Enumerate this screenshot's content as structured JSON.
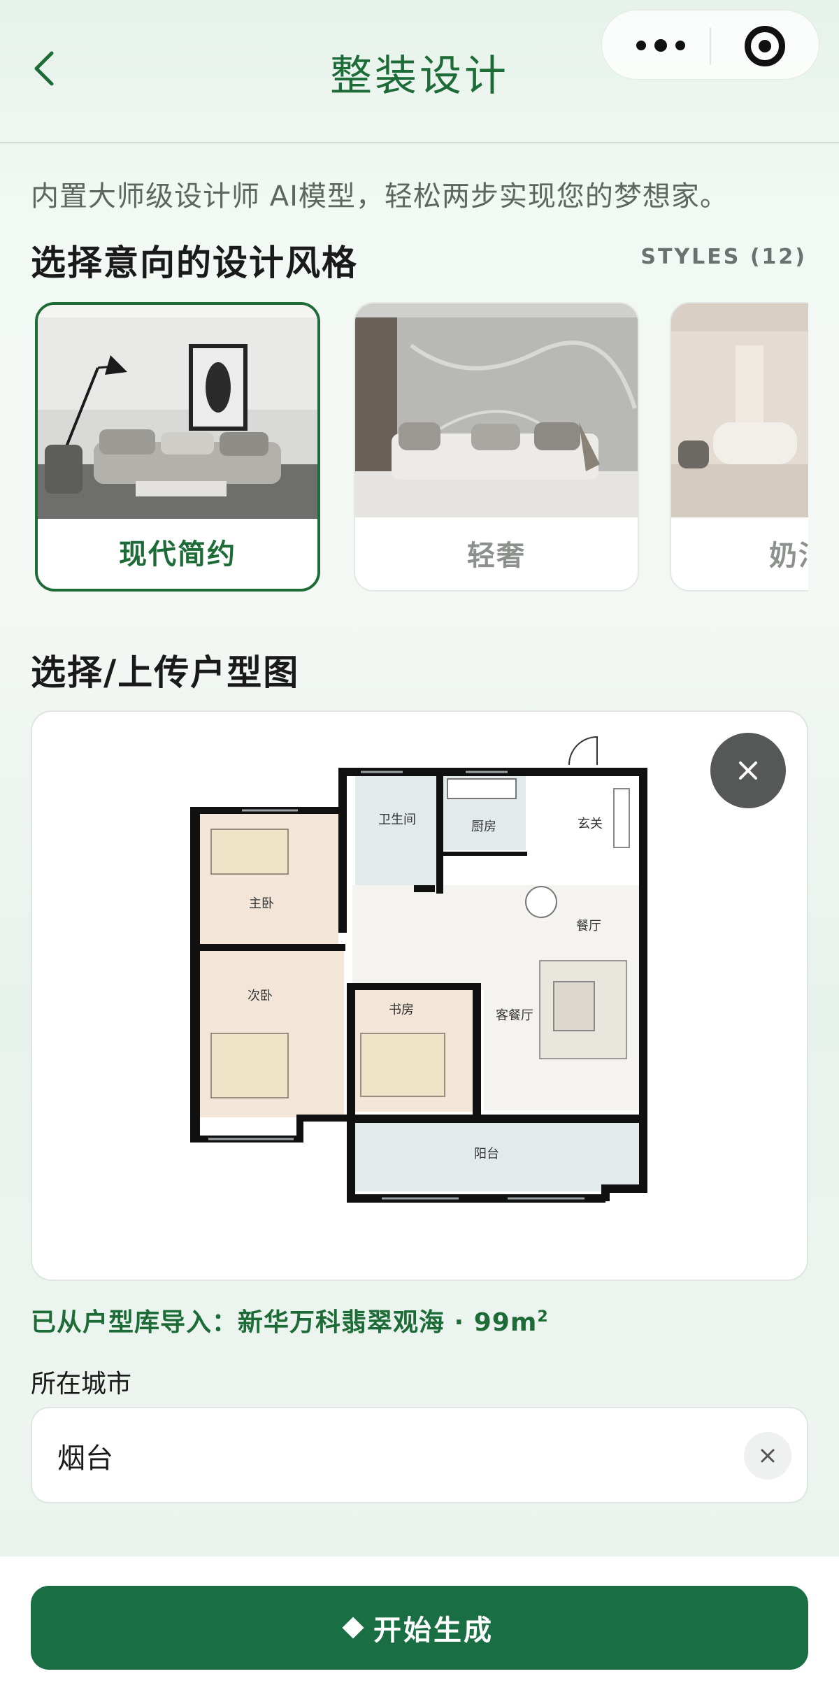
{
  "nav": {
    "title": "整装设计",
    "back_icon": "chevron-left-icon",
    "more_icon": "more-dots-icon",
    "close_icon": "target-icon"
  },
  "intro": {
    "subtitle": "内置大师级设计师 AI模型，轻松两步实现您的梦想家。"
  },
  "styles": {
    "title": "选择意向的设计风格",
    "count_label": "STYLES (12)",
    "items": [
      {
        "label": "现代简约",
        "selected": true
      },
      {
        "label": "轻奢",
        "selected": false
      },
      {
        "label": "奶油",
        "selected": false
      }
    ]
  },
  "floorplan": {
    "title": "选择/上传户型图",
    "rooms": [
      "卫生间",
      "厨房",
      "玄关",
      "主卧",
      "餐厅",
      "次卧",
      "书房",
      "客餐厅",
      "阳台"
    ],
    "import_prefix": "已从户型库导入：",
    "import_source": "新华万科翡翠观海 · 99m",
    "import_unit_sup": "2"
  },
  "city": {
    "label": "所在城市",
    "value": "烟台"
  },
  "footer": {
    "generate_label": "开始生成"
  },
  "colors": {
    "accent": "#1d6b36",
    "button": "#1a6e43"
  }
}
